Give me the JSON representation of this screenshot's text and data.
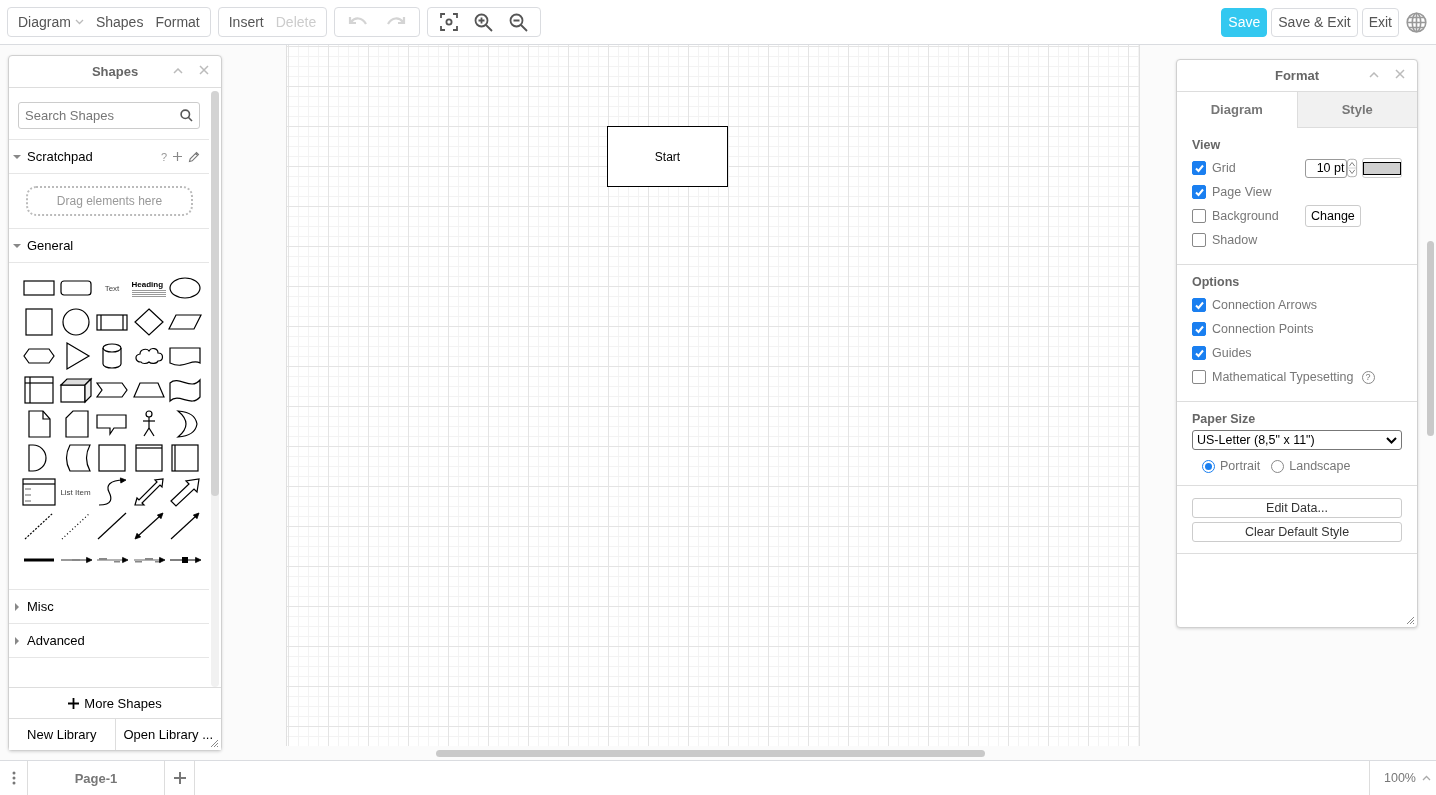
{
  "toolbar": {
    "menus": [
      {
        "label": "Diagram",
        "kind": "dropdown"
      },
      {
        "label": "Shapes",
        "kind": "plain"
      },
      {
        "label": "Format",
        "kind": "plain"
      }
    ],
    "edit": [
      {
        "label": "Insert",
        "disabled": false
      },
      {
        "label": "Delete",
        "disabled": true
      }
    ],
    "history": [
      {
        "kind": "undo",
        "disabled": true
      },
      {
        "kind": "redo",
        "disabled": true
      }
    ],
    "view": [
      {
        "kind": "fit"
      },
      {
        "kind": "zoom-in"
      },
      {
        "kind": "zoom-out"
      }
    ],
    "actions": [
      {
        "label": "Save",
        "kind": "primary"
      },
      {
        "label": "Save & Exit",
        "kind": "default"
      },
      {
        "label": "Exit",
        "kind": "default"
      }
    ]
  },
  "shapes_panel": {
    "title": "Shapes",
    "search": {
      "placeholder": "Search Shapes"
    },
    "scratchpad": {
      "title": "Scratchpad",
      "expanded": true,
      "help": "?",
      "drop_hint": "Drag elements here"
    },
    "sections": [
      {
        "title": "General",
        "expanded": true,
        "shapes": [
          {
            "kind": "rectangle"
          },
          {
            "kind": "rounded-rectangle"
          },
          {
            "kind": "text",
            "label": "Text"
          },
          {
            "kind": "heading",
            "label": "Heading"
          },
          {
            "kind": "ellipse"
          },
          {
            "kind": "square"
          },
          {
            "kind": "circle"
          },
          {
            "kind": "process"
          },
          {
            "kind": "diamond"
          },
          {
            "kind": "parallelogram"
          },
          {
            "kind": "hexagon"
          },
          {
            "kind": "triangle"
          },
          {
            "kind": "cylinder"
          },
          {
            "kind": "cloud"
          },
          {
            "kind": "document"
          },
          {
            "kind": "internal-storage"
          },
          {
            "kind": "cube"
          },
          {
            "kind": "step"
          },
          {
            "kind": "trapezoid"
          },
          {
            "kind": "tape"
          },
          {
            "kind": "note"
          },
          {
            "kind": "card"
          },
          {
            "kind": "callout"
          },
          {
            "kind": "actor"
          },
          {
            "kind": "or"
          },
          {
            "kind": "and"
          },
          {
            "kind": "data-storage"
          },
          {
            "kind": "square-frame"
          },
          {
            "kind": "container"
          },
          {
            "kind": "side-container"
          },
          {
            "kind": "list"
          },
          {
            "kind": "list-item",
            "label": "List Item"
          },
          {
            "kind": "curved-arrow"
          },
          {
            "kind": "double-block-arrow"
          },
          {
            "kind": "block-arrow"
          },
          {
            "kind": "dashed-line"
          },
          {
            "kind": "dotted-line"
          },
          {
            "kind": "line"
          },
          {
            "kind": "bidirectional-line"
          },
          {
            "kind": "directional-line"
          },
          {
            "kind": "thick-line"
          },
          {
            "kind": "labeled-connector"
          },
          {
            "kind": "double-labeled-connector"
          },
          {
            "kind": "triple-labeled-connector"
          },
          {
            "kind": "symbol-connector"
          }
        ]
      },
      {
        "title": "Misc",
        "expanded": false
      },
      {
        "title": "Advanced",
        "expanded": false
      }
    ],
    "more": "More Shapes",
    "footer": [
      "New Library",
      "Open Library ..."
    ]
  },
  "canvas": {
    "shapes": [
      {
        "kind": "rectangle",
        "label": "Start"
      }
    ]
  },
  "format_panel": {
    "title": "Format",
    "tabs": [
      {
        "label": "Diagram",
        "selected": true
      },
      {
        "label": "Style",
        "selected": false
      }
    ],
    "view": {
      "title": "View",
      "options": [
        {
          "label": "Grid",
          "checked": true,
          "kind": "grid",
          "value": "10 pt"
        },
        {
          "label": "Page View",
          "checked": true,
          "kind": "plain"
        },
        {
          "label": "Background",
          "checked": false,
          "kind": "button",
          "button": "Change"
        },
        {
          "label": "Shadow",
          "checked": false,
          "kind": "plain"
        }
      ]
    },
    "options": {
      "title": "Options",
      "items": [
        {
          "label": "Connection Arrows",
          "checked": true
        },
        {
          "label": "Connection Points",
          "checked": true
        },
        {
          "label": "Guides",
          "checked": true
        },
        {
          "label": "Mathematical Typesetting",
          "checked": false,
          "help": "?"
        }
      ]
    },
    "paper": {
      "title": "Paper Size",
      "value": "US-Letter (8,5\" x 11\")",
      "orientations": [
        {
          "label": "Portrait",
          "selected": true
        },
        {
          "label": "Landscape",
          "selected": false
        }
      ]
    },
    "buttons": [
      "Edit Data...",
      "Clear Default Style"
    ]
  },
  "footer": {
    "pages": [
      {
        "label": "Page-1",
        "selected": true
      }
    ],
    "zoom": "100%"
  }
}
